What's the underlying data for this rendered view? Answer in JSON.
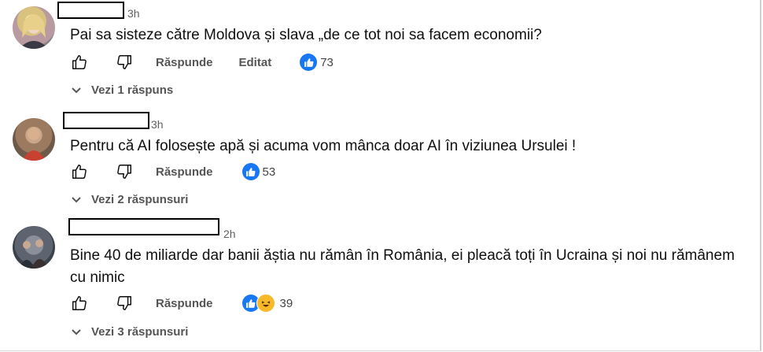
{
  "comments": [
    {
      "time": "3h",
      "text": "Pai sa sisteze către Moldova și slava „de ce tot noi sa facem economii?",
      "reply_label": "Răspunde",
      "edited_label": "Editat",
      "reaction_count": "73",
      "replies_label": "Vezi 1 răspuns"
    },
    {
      "time": "3h",
      "text": "Pentru că AI folosește apă și acuma vom mânca doar AI în viziunea Ursulei !",
      "reply_label": "Răspunde",
      "reaction_count": "53",
      "replies_label": "Vezi 2 răspunsuri"
    },
    {
      "time": "2h",
      "text": "Bine 40 de miliarde dar banii ăștia nu rămân în România, ei pleacă toți în Ucraina și noi nu rămânem cu nimic",
      "reply_label": "Răspunde",
      "reaction_count": "39",
      "replies_label": "Vezi 3 răspunsuri"
    }
  ],
  "colors": {
    "like_blue": "#1877f2",
    "haha_yellow": "#f7b928",
    "muted_text": "#555555"
  }
}
